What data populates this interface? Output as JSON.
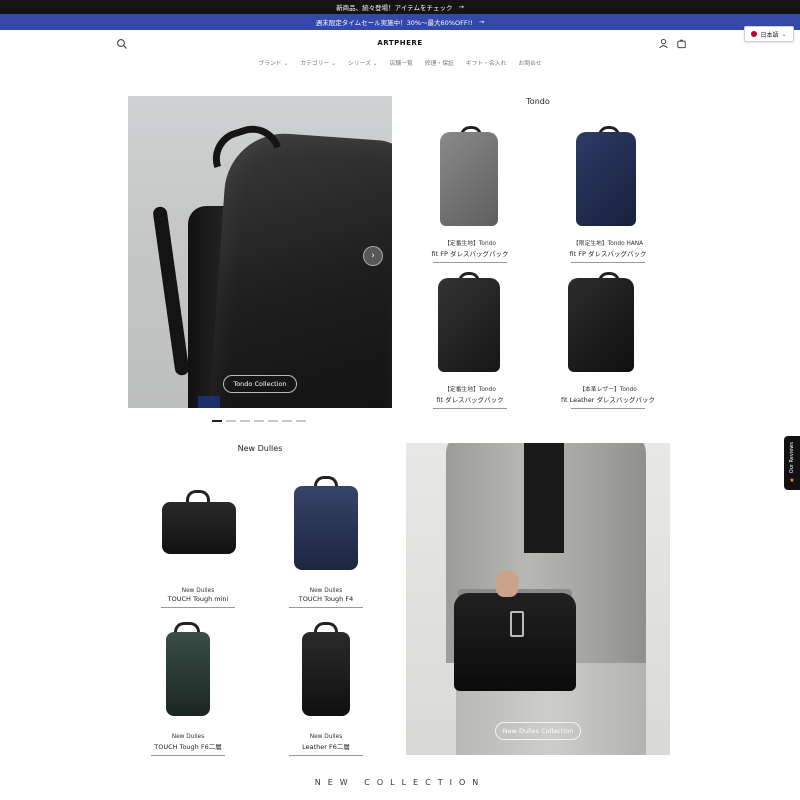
{
  "announcements": {
    "top_text": "新商品、続々登場！アイテムをチェック",
    "sale_text": "週末限定タイムセール実施中！30%〜最大60%OFF!!",
    "arrow": "→"
  },
  "header": {
    "logo": "ARTPHERE",
    "language": "日本語"
  },
  "nav": {
    "items": [
      "ブランド ⌄",
      "カテゴリー ⌄",
      "シリーズ ⌄",
      "店舗一覧",
      "修理・保証",
      "ギフト・名入れ",
      "お問合せ"
    ]
  },
  "hero": {
    "cta": "Tondo Collection",
    "arrow": "›",
    "slide_count": 7,
    "active_slide": 1
  },
  "tondo": {
    "title": "Tondo",
    "products": [
      {
        "line1": "【定番生地】Tondo",
        "line2": "fit FP ダレスバッグパック",
        "color": "#6f6f6f"
      },
      {
        "line1": "【限定生地】Tondo HANA",
        "line2": "fit FP ダレスバッグパック",
        "color": "#1f2a4e"
      },
      {
        "line1": "【定番生地】Tondo",
        "line2": "fit ダレスバッグパック",
        "color": "#232323"
      },
      {
        "line1": "【本革レザー】Tondo",
        "line2": "fit Leather ダレスバッグパック",
        "color": "#1c1c1c"
      }
    ]
  },
  "dulles": {
    "title": "New Dulles",
    "cta": "New Dulles Collection",
    "products": [
      {
        "line1": "New Dulles",
        "line2": "TOUCH Tough mini",
        "color": "#1d1d1d"
      },
      {
        "line1": "New Dulles",
        "line2": "TOUCH Tough F4",
        "color": "#2a3552"
      },
      {
        "line1": "New Dulles",
        "line2": "TOUCH Tough F6二層",
        "color": "#2b3b36"
      },
      {
        "line1": "New Dulles",
        "line2": "Leather F6二層",
        "color": "#1a1a1a"
      }
    ]
  },
  "new_collection": "NEW COLLECTION",
  "reviews": {
    "label": "Our Reviews",
    "star": "★"
  }
}
